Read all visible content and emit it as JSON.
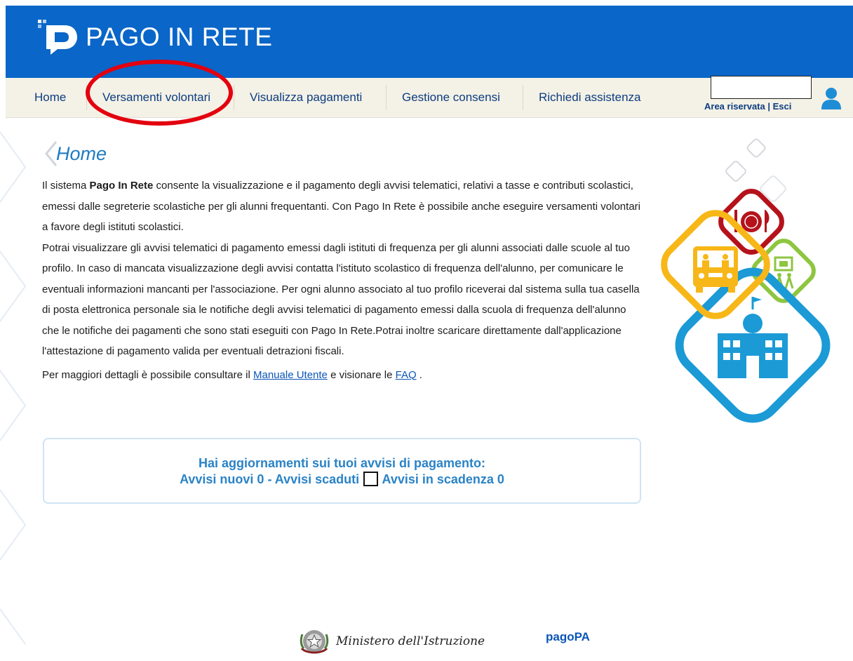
{
  "header": {
    "app_title": "PAGO IN RETE",
    "brand_color": "#0a66c8"
  },
  "nav": {
    "items": [
      {
        "label": "Home"
      },
      {
        "label": "Versamenti volontari"
      },
      {
        "label": "Visualizza pagamenti"
      },
      {
        "label": "Gestione consensi"
      },
      {
        "label": "Richiedi assistenza"
      }
    ],
    "area_riservata": "Area riservata",
    "separator": "|",
    "esci": "Esci",
    "highlight_color": "#e3000f"
  },
  "page": {
    "title": "Home",
    "intro_pre": "Il sistema ",
    "intro_bold": "Pago In Rete",
    "intro_post": " consente la visualizzazione e il pagamento degli avvisi telematici, relativi a tasse e contributi scolastici, emessi dalle segreterie scolastiche per gli alunni frequentanti. Con Pago In Rete è possibile anche eseguire versamenti volontari a favore degli istituti scolastici.",
    "paragraph2": "Potrai visualizzare gli avvisi telematici di pagamento emessi dagli istituti di frequenza per gli alunni associati dalle scuole al tuo profilo. In caso di mancata visualizzazione degli avvisi contatta l'istituto scolastico di frequenza dell'alunno, per comunicare le eventuali informazioni mancanti per l'associazione. Per ogni alunno associato al tuo profilo riceverai dal sistema sulla tua casella di posta elettronica personale sia le notifiche degli avvisi telematici di pagamento emessi dalla scuola di frequenza dell'alunno che le notifiche dei pagamenti che sono stati eseguiti con Pago In Rete.Potrai inoltre scaricare direttamente dall'applicazione l'attestazione di pagamento valida per eventuali detrazioni fiscali.",
    "details_pre": "Per maggiori dettagli è possibile consultare il ",
    "manual_link": "Manuale Utente",
    "details_mid": " e visionare le ",
    "faq_link": "FAQ",
    "details_post": " ."
  },
  "notice": {
    "line1": "Hai aggiornamenti sui tuoi avvisi di pagamento:",
    "line2_pre": "Avvisi nuovi 0 - Avvisi scaduti ",
    "line2_post": " Avvisi in scadenza 0",
    "text_color": "#2a83c6"
  },
  "footer": {
    "ministry": "Ministero dell'Istruzione",
    "pagopa": "pagoPA"
  },
  "icons": [
    "pagoinrete-logo-icon",
    "user-icon",
    "dining-icon",
    "school-bus-icon",
    "museum-icon",
    "school-building-icon",
    "italian-emblem-icon"
  ]
}
